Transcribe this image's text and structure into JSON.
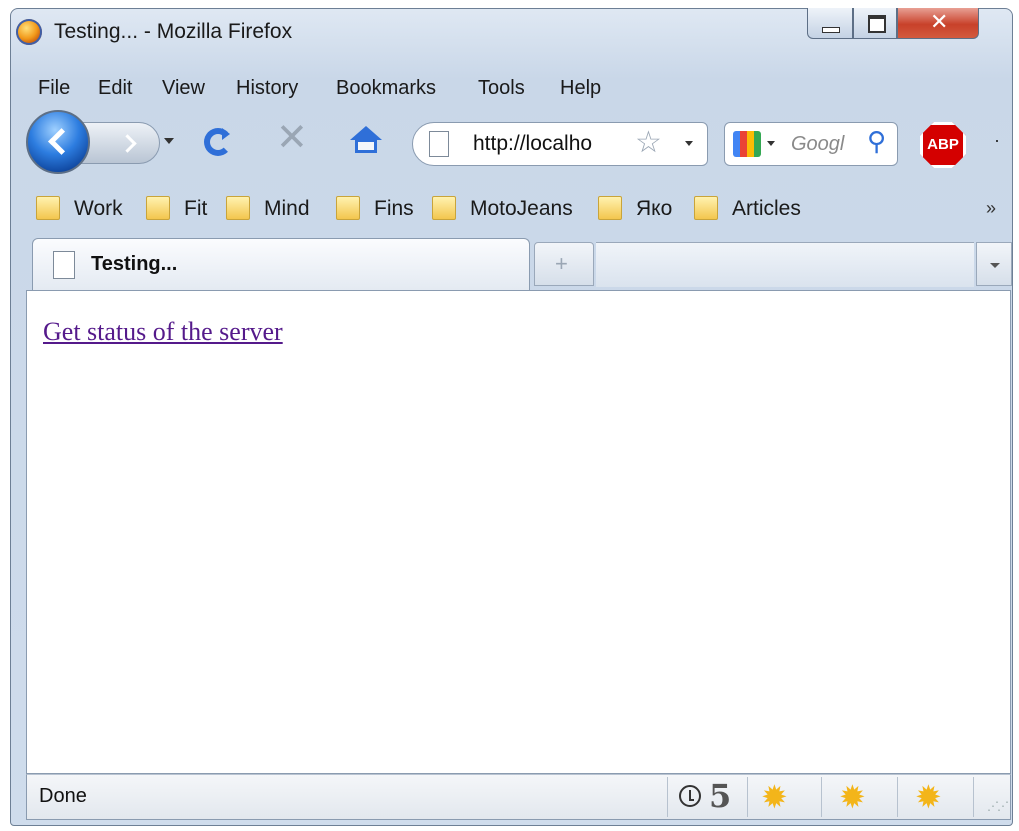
{
  "window": {
    "title": "Testing... - Mozilla Firefox"
  },
  "menu": [
    {
      "label": "File"
    },
    {
      "label": "Edit"
    },
    {
      "label": "View"
    },
    {
      "label": "History"
    },
    {
      "label": "Bookmarks"
    },
    {
      "label": "Tools"
    },
    {
      "label": "Help"
    }
  ],
  "nav": {
    "url": "http://localho",
    "search_placeholder": "Googl",
    "abp_label": "ABP",
    "more": "·"
  },
  "bookmarks": [
    {
      "label": "Work"
    },
    {
      "label": "Fit"
    },
    {
      "label": "Mind"
    },
    {
      "label": "Fins"
    },
    {
      "label": "MotoJeans"
    },
    {
      "label": "Яко"
    },
    {
      "label": "Articles"
    }
  ],
  "bookmarks_more": "»",
  "tab": {
    "label": "Testing...",
    "new_tab_symbol": "+"
  },
  "content": {
    "link_text": "Get status of the server"
  },
  "status": {
    "text": "Done",
    "count": "5"
  }
}
